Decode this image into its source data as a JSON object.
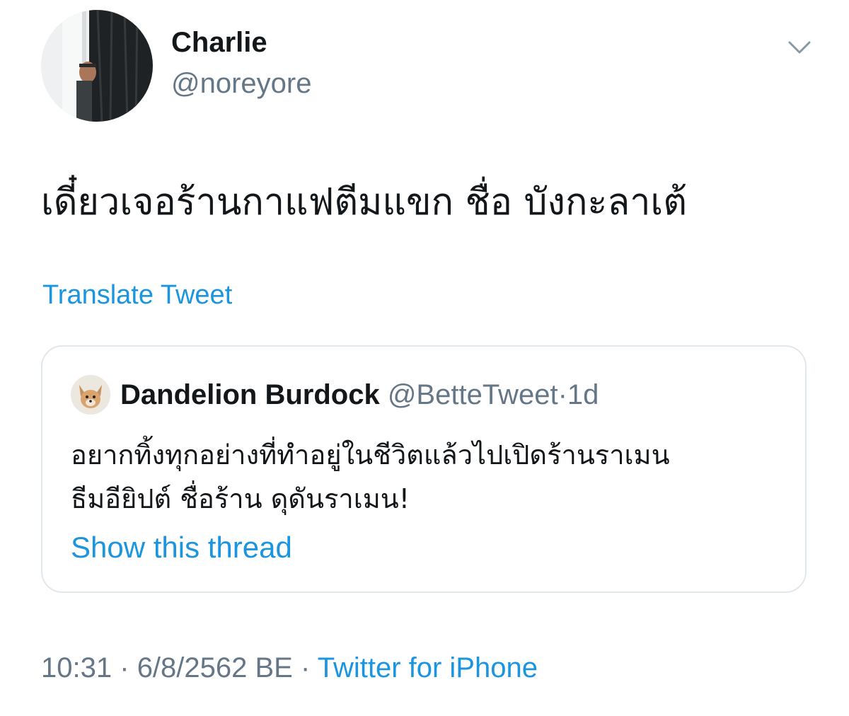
{
  "author": {
    "name": "Charlie",
    "handle": "@noreyore"
  },
  "tweet": {
    "text": "เดี๋ยวเจอร้านกาแฟตีมแขก ชื่อ บังกะลาเต้",
    "translate_label": "Translate Tweet"
  },
  "quoted_tweet": {
    "name": "Dandelion Burdock",
    "handle": "@BetteTweet",
    "separator": "·",
    "time": "1d",
    "text_lines": [
      "อยากทิ้งทุกอย่างที่ทำอยู่ในชีวิตแล้วไปเปิดร้านราเมน",
      "ธีมอียิปต์ ชื่อร้าน ดุดันราเมน!"
    ],
    "show_thread_label": "Show this thread"
  },
  "meta": {
    "time": "10:31",
    "sep1": "·",
    "date": "6/8/2562 BE",
    "sep2": "·",
    "source": "Twitter for iPhone"
  },
  "icons": {
    "menu": "chevron-down-icon"
  },
  "colors": {
    "link": "#1b95e0",
    "secondary": "#657786",
    "primary_text": "#14171a",
    "border": "#e1e8ed"
  }
}
